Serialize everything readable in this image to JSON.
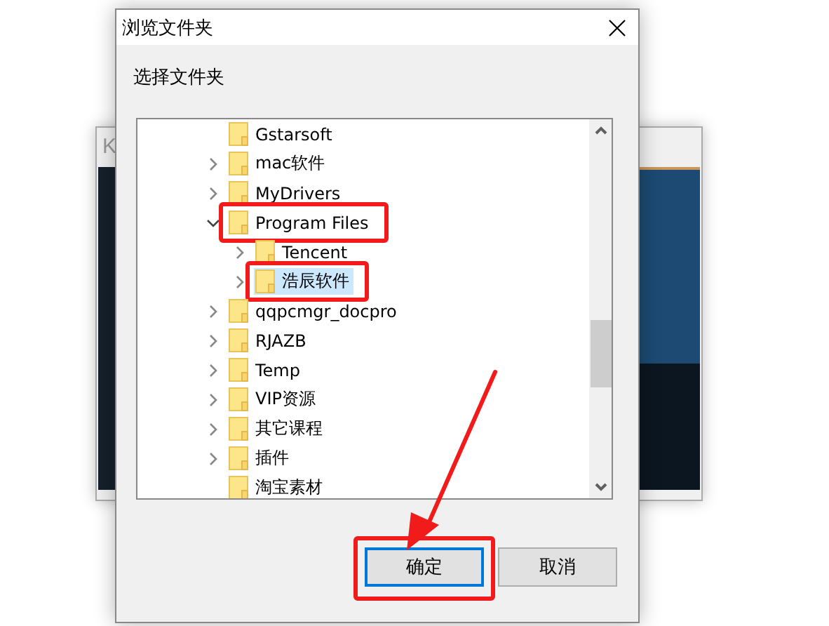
{
  "background_window": {
    "title": "K"
  },
  "dialog": {
    "title": "浏览文件夹",
    "prompt": "选择文件夹",
    "tree": [
      {
        "label": "Gstarsoft",
        "kind": "leaf",
        "selected": false,
        "highlighted": false
      },
      {
        "label": "mac软件",
        "kind": "collapsed",
        "selected": false,
        "highlighted": false
      },
      {
        "label": "MyDrivers",
        "kind": "collapsed",
        "selected": false,
        "highlighted": false
      },
      {
        "label": "Program Files",
        "kind": "expanded",
        "selected": false,
        "highlighted": true,
        "children": [
          {
            "label": "Tencent",
            "kind": "collapsed",
            "selected": false,
            "highlighted": false
          },
          {
            "label": "浩辰软件",
            "kind": "collapsed",
            "selected": true,
            "highlighted": true
          }
        ]
      },
      {
        "label": "qqpcmgr_docpro",
        "kind": "collapsed",
        "selected": false,
        "highlighted": false
      },
      {
        "label": "RJAZB",
        "kind": "collapsed",
        "selected": false,
        "highlighted": false
      },
      {
        "label": "Temp",
        "kind": "collapsed",
        "selected": false,
        "highlighted": false
      },
      {
        "label": "VIP资源",
        "kind": "collapsed",
        "selected": false,
        "highlighted": false
      },
      {
        "label": "其它课程",
        "kind": "collapsed",
        "selected": false,
        "highlighted": false
      },
      {
        "label": "插件",
        "kind": "collapsed",
        "selected": false,
        "highlighted": false
      },
      {
        "label": "淘宝素材",
        "kind": "leaf",
        "selected": false,
        "highlighted": false
      }
    ],
    "buttons": [
      {
        "label": "确定",
        "default": true,
        "highlighted": true,
        "arrow": true
      },
      {
        "label": "取消",
        "default": false,
        "highlighted": false,
        "arrow": false
      }
    ]
  }
}
